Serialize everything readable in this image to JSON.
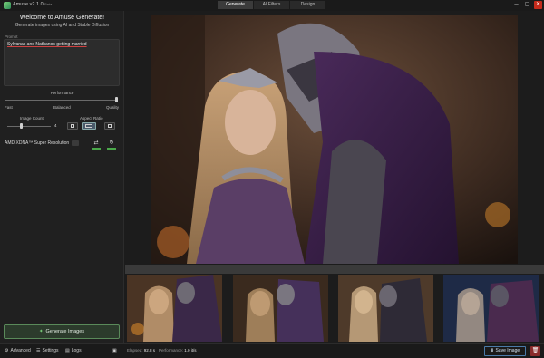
{
  "window": {
    "title": "Amuse v2.1.0",
    "version_tag": "Beta",
    "tabs": [
      "Generate",
      "AI Filters",
      "Design"
    ],
    "controls": {
      "minimize": "─",
      "maximize": "▢",
      "close": "✕"
    }
  },
  "left_panel": {
    "welcome": "Welcome to Amuse Generate!",
    "subtitle": "Generate images using AI and Stable Diffusion",
    "prompt_label": "Prompt",
    "prompt_text": "Sylvanas and Nathanos getting married",
    "performance": {
      "label": "Performance",
      "ticks": [
        "Fast",
        "Balanced",
        "Quality"
      ],
      "level": 1.0
    },
    "image_count": {
      "label": "Image Count",
      "value": "4",
      "level": 0.15
    },
    "aspect_ratio": {
      "label": "Aspect Ratio",
      "options": [
        "portrait",
        "landscape",
        "square"
      ],
      "selected": 1
    },
    "upscale_label": "AMD XDNA™ Super Resolution",
    "generate_label": "Generate Images"
  },
  "bottom_bar": {
    "advanced": "Advanced",
    "settings": "Settings",
    "logs": "Logs",
    "elapsed_label": "Elapsed:",
    "elapsed_value": "92.8 s",
    "performance_label": "Performance:",
    "performance_value": "1.0 it/s",
    "save_label": "Save Image"
  },
  "colors": {
    "accent_green": "#5a8a5a",
    "accent_blue": "#4a7aa8",
    "danger": "#8a2b2b"
  }
}
